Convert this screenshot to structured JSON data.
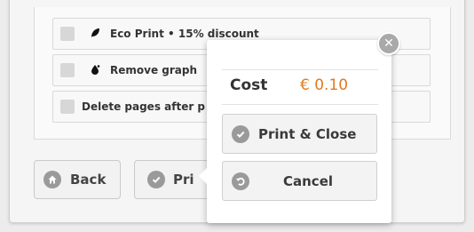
{
  "options": {
    "eco_print": {
      "label": "Eco Print • 15% discount",
      "icon": "leaf-icon"
    },
    "remove_graphics": {
      "label": "Remove graph",
      "icon": "ink-drop-icon"
    },
    "delete_pages": {
      "label": "Delete pages after p"
    }
  },
  "footer": {
    "back_label": "Back",
    "print_label": "Pri"
  },
  "popup": {
    "cost_label": "Cost",
    "cost_value": "€ 0.10",
    "print_close_label": "Print & Close",
    "cancel_label": "Cancel"
  },
  "colors": {
    "cost": "#e07a1f",
    "icon_bg": "#9a9a9a"
  }
}
